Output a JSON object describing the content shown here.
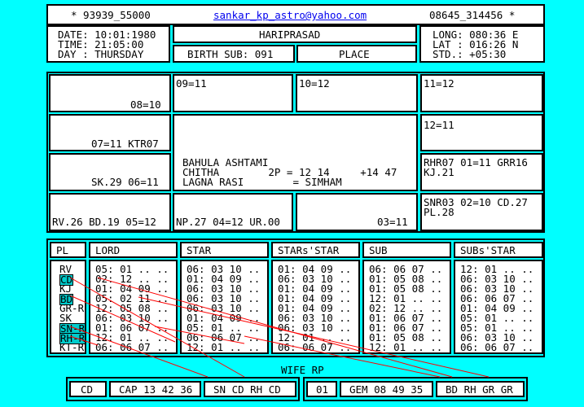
{
  "header": {
    "left_id": "* 93939_55000",
    "email": "sankar_kp_astro@yahoo.com",
    "right_id": "08645_314456 *"
  },
  "birth": {
    "date": "DATE: 10:01:1980",
    "time": "TIME: 21:05:00",
    "day": "DAY : THURSDAY",
    "name": "HARIPRASAD",
    "birth_sub": "BIRTH SUB: 091",
    "place": "PLACE",
    "long": "LONG: 080:36 E",
    "lat": "LAT : 016:26 N",
    "std": "STD.: +05:30"
  },
  "chart": {
    "h09": "09=11",
    "h10": "10=12",
    "h11": "11=12",
    "h08": "08=10",
    "h12": "12=11",
    "h07": "07=11 KTR07",
    "h01_line1": "RHR07 01=11 GRR16",
    "h01_line2": "KJ.21",
    "h06": "SK.29 06=11",
    "h02_line1": "SNR03 02=10 CD.27",
    "h02_line2": "PL.28",
    "h05": "RV.26 BD.19 05=12",
    "h04": "NP.27 04=12 UR.00",
    "h03": "03=11",
    "center_line1": "BAHULA ASHTAMI",
    "center_line2": "CHITHA        2P = 12 14     +14 47",
    "center_line3": "LAGNA RASI        = SIMHAM"
  },
  "table": {
    "headers": [
      "PL",
      "LORD",
      "STAR",
      "STARs'STAR",
      "SUB",
      "SUBs'STAR"
    ],
    "planets": [
      "RV",
      "CD",
      "KJ",
      "BD",
      "GR-R",
      "SK",
      "SN-R",
      "RH-R",
      "KT-R"
    ],
    "lord": [
      "05: 01 .. ..",
      "02: 12 .. ..",
      "01: 04 09 ..",
      "05: 02 11 ..",
      "12: 05 08 ..",
      "06: 03 10 ..",
      "01: 06 07 ..",
      "12: 01 .. ..",
      "06: 06 07 .."
    ],
    "star": [
      "06: 03 10 ..",
      "01: 04 09 ..",
      "06: 03 10 ..",
      "06: 03 10 ..",
      "06: 03 10 ..",
      "01: 04 09 ..",
      "05: 01 .. ..",
      "06: 06 07 ..",
      "12: 01 .. .."
    ],
    "starsstar": [
      "01: 04 09 ..",
      "06: 03 10 ..",
      "01: 04 09 ..",
      "01: 04 09 ..",
      "01: 04 09 ..",
      "06: 03 10 ..",
      "06: 03 10 ..",
      "12: 01 .. ..",
      "06: 06 07 .."
    ],
    "sub": [
      "06: 06 07 ..",
      "01: 05 08 ..",
      "01: 05 08 ..",
      "12: 01 .. ..",
      "02: 12 .. ..",
      "01: 06 07 ..",
      "01: 06 07 ..",
      "01: 05 08 ..",
      "12: 01 .. .."
    ],
    "subsstar": [
      "12: 01 .. ..",
      "06: 03 10 ..",
      "06: 03 10 ..",
      "06: 06 07 ..",
      "01: 04 09 ..",
      "05: 01 .. ..",
      "05: 01 .. ..",
      "06: 03 10 ..",
      "06: 06 07 .."
    ]
  },
  "wife_rp": {
    "title": "WIFE RP",
    "left": [
      "CD",
      "CAP 13 42 36",
      "SN CD RH CD"
    ],
    "right": [
      "01",
      "GEM 08 49 35",
      "BD RH GR GR"
    ]
  },
  "colors": {
    "background": "#00ffff",
    "highlight": "#00cccc",
    "lines": "#ff0000"
  }
}
